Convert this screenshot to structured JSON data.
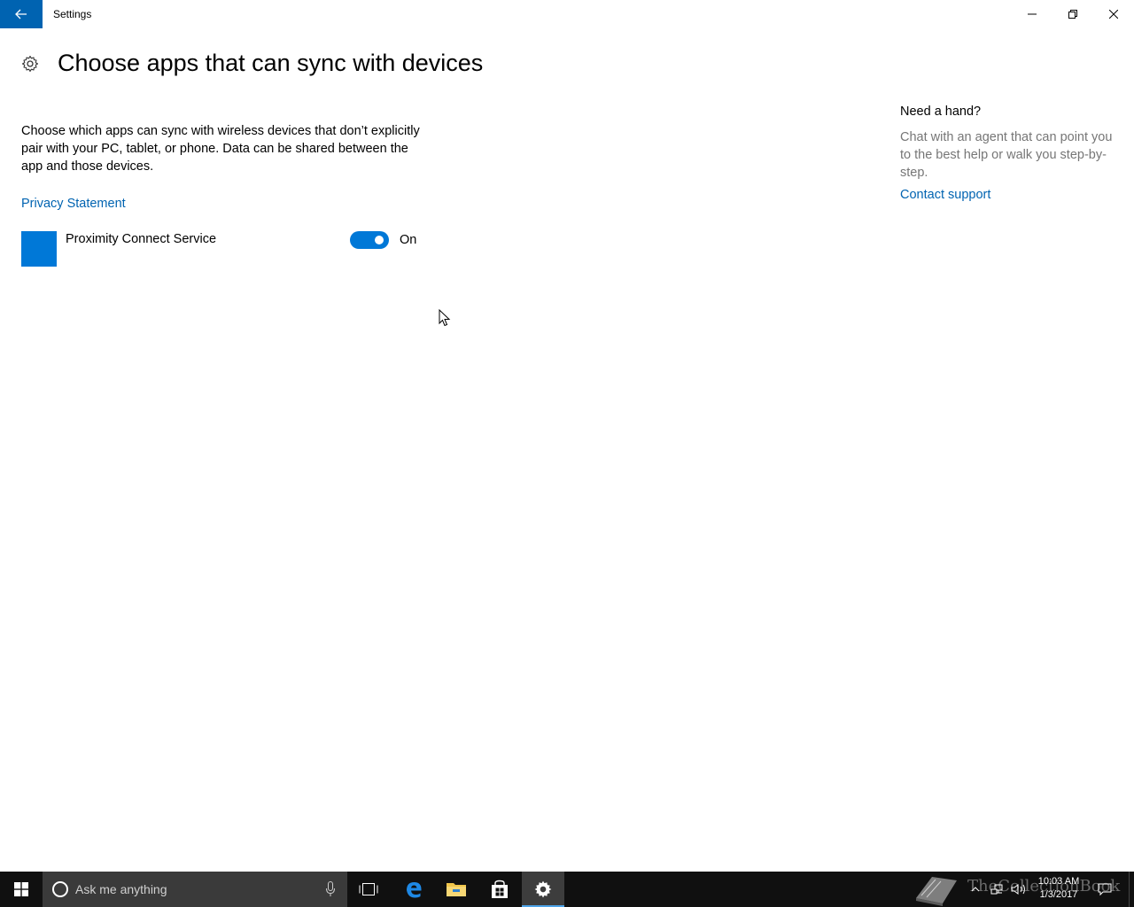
{
  "window": {
    "app_title": "Settings"
  },
  "header": {
    "title": "Choose apps that can sync with devices"
  },
  "main": {
    "description": "Choose which apps can sync with wireless devices that don’t explicitly pair with your PC, tablet, or phone. Data can be shared between the app and those devices.",
    "privacy_link": "Privacy Statement",
    "apps": [
      {
        "name": "Proximity Connect Service",
        "toggle_state": "On",
        "enabled": true
      }
    ]
  },
  "help_panel": {
    "title": "Need a hand?",
    "text": "Chat with an agent that can point you to the best help or walk you step-by-step.",
    "link": "Contact support"
  },
  "taskbar": {
    "search_placeholder": "Ask me anything",
    "clock_time": "10:03 AM",
    "clock_date": "1/3/2017",
    "watermark": "TheCollectionBook"
  },
  "colors": {
    "accent": "#0078d7",
    "link": "#0063b1",
    "taskbar": "#101010"
  }
}
